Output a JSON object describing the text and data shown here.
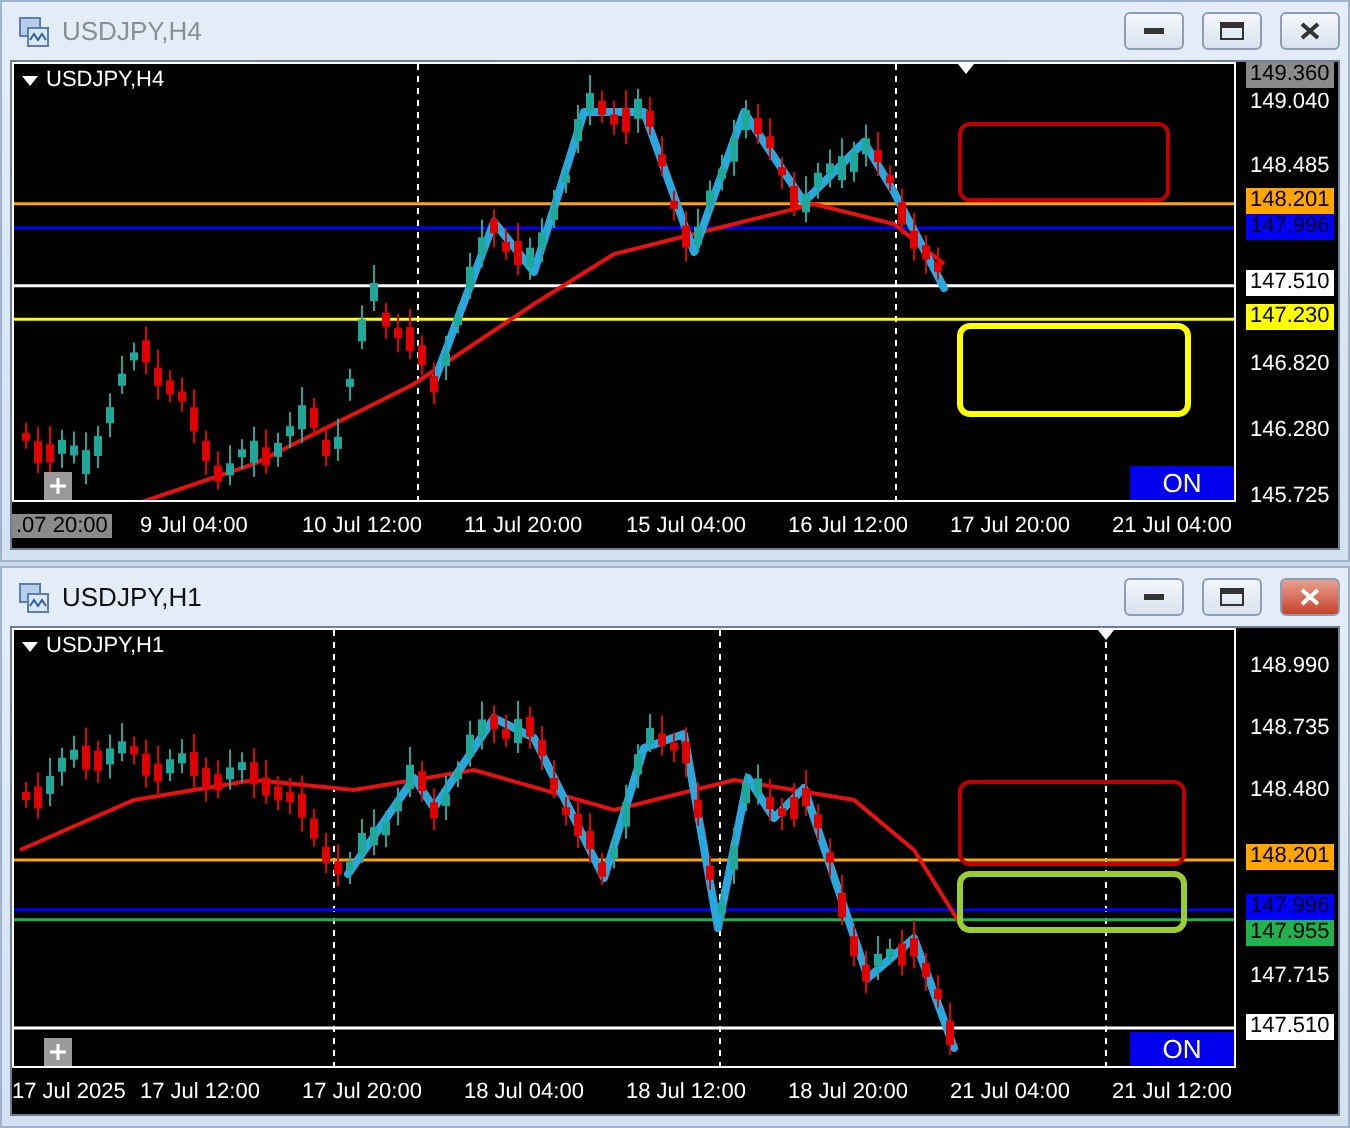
{
  "windows": [
    {
      "title": "USDJPY,H4",
      "active": false,
      "symbol_label": "USDJPY,H4",
      "button": "ON",
      "price_labels": [
        {
          "text": "149.360",
          "kind": "highlight"
        },
        {
          "text": "149.040",
          "kind": "tick"
        },
        {
          "text": "148.485",
          "kind": "tick"
        },
        {
          "text": "146.820",
          "kind": "tick"
        },
        {
          "text": "146.280",
          "kind": "tick"
        },
        {
          "text": "145.725",
          "kind": "tick"
        }
      ],
      "levels": [
        {
          "price": "148.201",
          "color": "#ffa500"
        },
        {
          "price": "147.996",
          "color": "#0000ff"
        },
        {
          "price": "147.510",
          "color": "#ffffff"
        },
        {
          "price": "147.230",
          "color": "#ffff00"
        }
      ],
      "zones": [
        {
          "color": "#c00000"
        },
        {
          "color": "#ffff00"
        }
      ],
      "time_labels": [
        {
          "text": ".07 20:00",
          "kind": "highlight"
        },
        {
          "text": "9 Jul 04:00",
          "kind": "tick"
        },
        {
          "text": "10 Jul 12:00",
          "kind": "tick"
        },
        {
          "text": "11 Jul 20:00",
          "kind": "tick"
        },
        {
          "text": "15 Jul 04:00",
          "kind": "tick"
        },
        {
          "text": "16 Jul 12:00",
          "kind": "tick"
        },
        {
          "text": "17 Jul 20:00",
          "kind": "tick"
        },
        {
          "text": "21 Jul 04:00",
          "kind": "tick"
        }
      ]
    },
    {
      "title": "USDJPY,H1",
      "active": true,
      "symbol_label": "USDJPY,H1",
      "button": "ON",
      "price_labels": [
        {
          "text": "148.990",
          "kind": "tick"
        },
        {
          "text": "148.735",
          "kind": "tick"
        },
        {
          "text": "148.480",
          "kind": "tick"
        },
        {
          "text": "147.715",
          "kind": "tick"
        }
      ],
      "levels": [
        {
          "price": "148.201",
          "color": "#ffa500"
        },
        {
          "price": "147.996",
          "color": "#0000ff"
        },
        {
          "price": "147.955",
          "color": "#22b14c"
        },
        {
          "price": "147.510",
          "color": "#ffffff"
        }
      ],
      "zones": [
        {
          "color": "#c00000"
        },
        {
          "color": "#9acd32"
        }
      ],
      "time_labels": [
        {
          "text": "17 Jul 2025",
          "kind": "tick"
        },
        {
          "text": "17 Jul 12:00",
          "kind": "tick"
        },
        {
          "text": "17 Jul 20:00",
          "kind": "tick"
        },
        {
          "text": "18 Jul 04:00",
          "kind": "tick"
        },
        {
          "text": "18 Jul 12:00",
          "kind": "tick"
        },
        {
          "text": "18 Jul 20:00",
          "kind": "tick"
        },
        {
          "text": "21 Jul 04:00",
          "kind": "tick"
        },
        {
          "text": "21 Jul 12:00",
          "kind": "tick"
        }
      ]
    }
  ]
}
